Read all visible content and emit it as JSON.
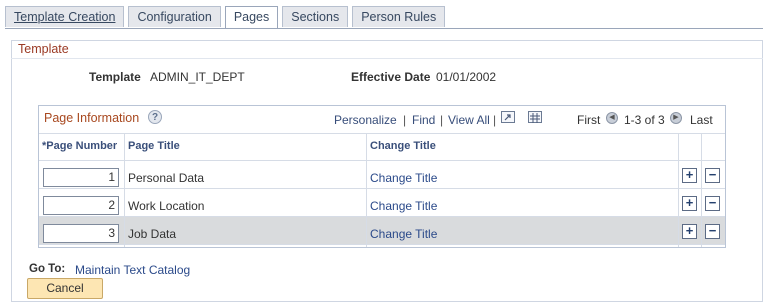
{
  "tabs": [
    {
      "label": "Template Creation",
      "active": false
    },
    {
      "label": "Configuration",
      "active": false
    },
    {
      "label": "Pages",
      "active": true
    },
    {
      "label": "Sections",
      "active": false
    },
    {
      "label": "Person Rules",
      "active": false
    }
  ],
  "panel": {
    "title": "Template"
  },
  "template": {
    "label": "Template",
    "value": "ADMIN_IT_DEPT"
  },
  "effective_date": {
    "label": "Effective Date",
    "value": "01/01/2002"
  },
  "grid": {
    "title": "Page Information",
    "help_icon": "?",
    "personalize": "Personalize",
    "find": "Find",
    "view_all": "View All",
    "sep": "|",
    "first": "First",
    "range": "1-3 of 3",
    "last": "Last",
    "columns": [
      "*Page Number",
      "Page Title",
      "Change Title"
    ],
    "rows": [
      {
        "number": "1",
        "title": "Personal Data",
        "change": "Change Title"
      },
      {
        "number": "2",
        "title": "Work Location",
        "change": "Change Title"
      },
      {
        "number": "3",
        "title": "Job Data",
        "change": "Change Title"
      }
    ],
    "add_symbol": "+",
    "remove_symbol": "−"
  },
  "goto": {
    "label": "Go To:",
    "link": "Maintain Text Catalog"
  },
  "cancel_label": "Cancel",
  "colors": {
    "accent_title": "#9b3a24",
    "link": "#2b4a8a",
    "selected_row": "#d9dbdd",
    "cancel_bg": "#fde6b3"
  }
}
